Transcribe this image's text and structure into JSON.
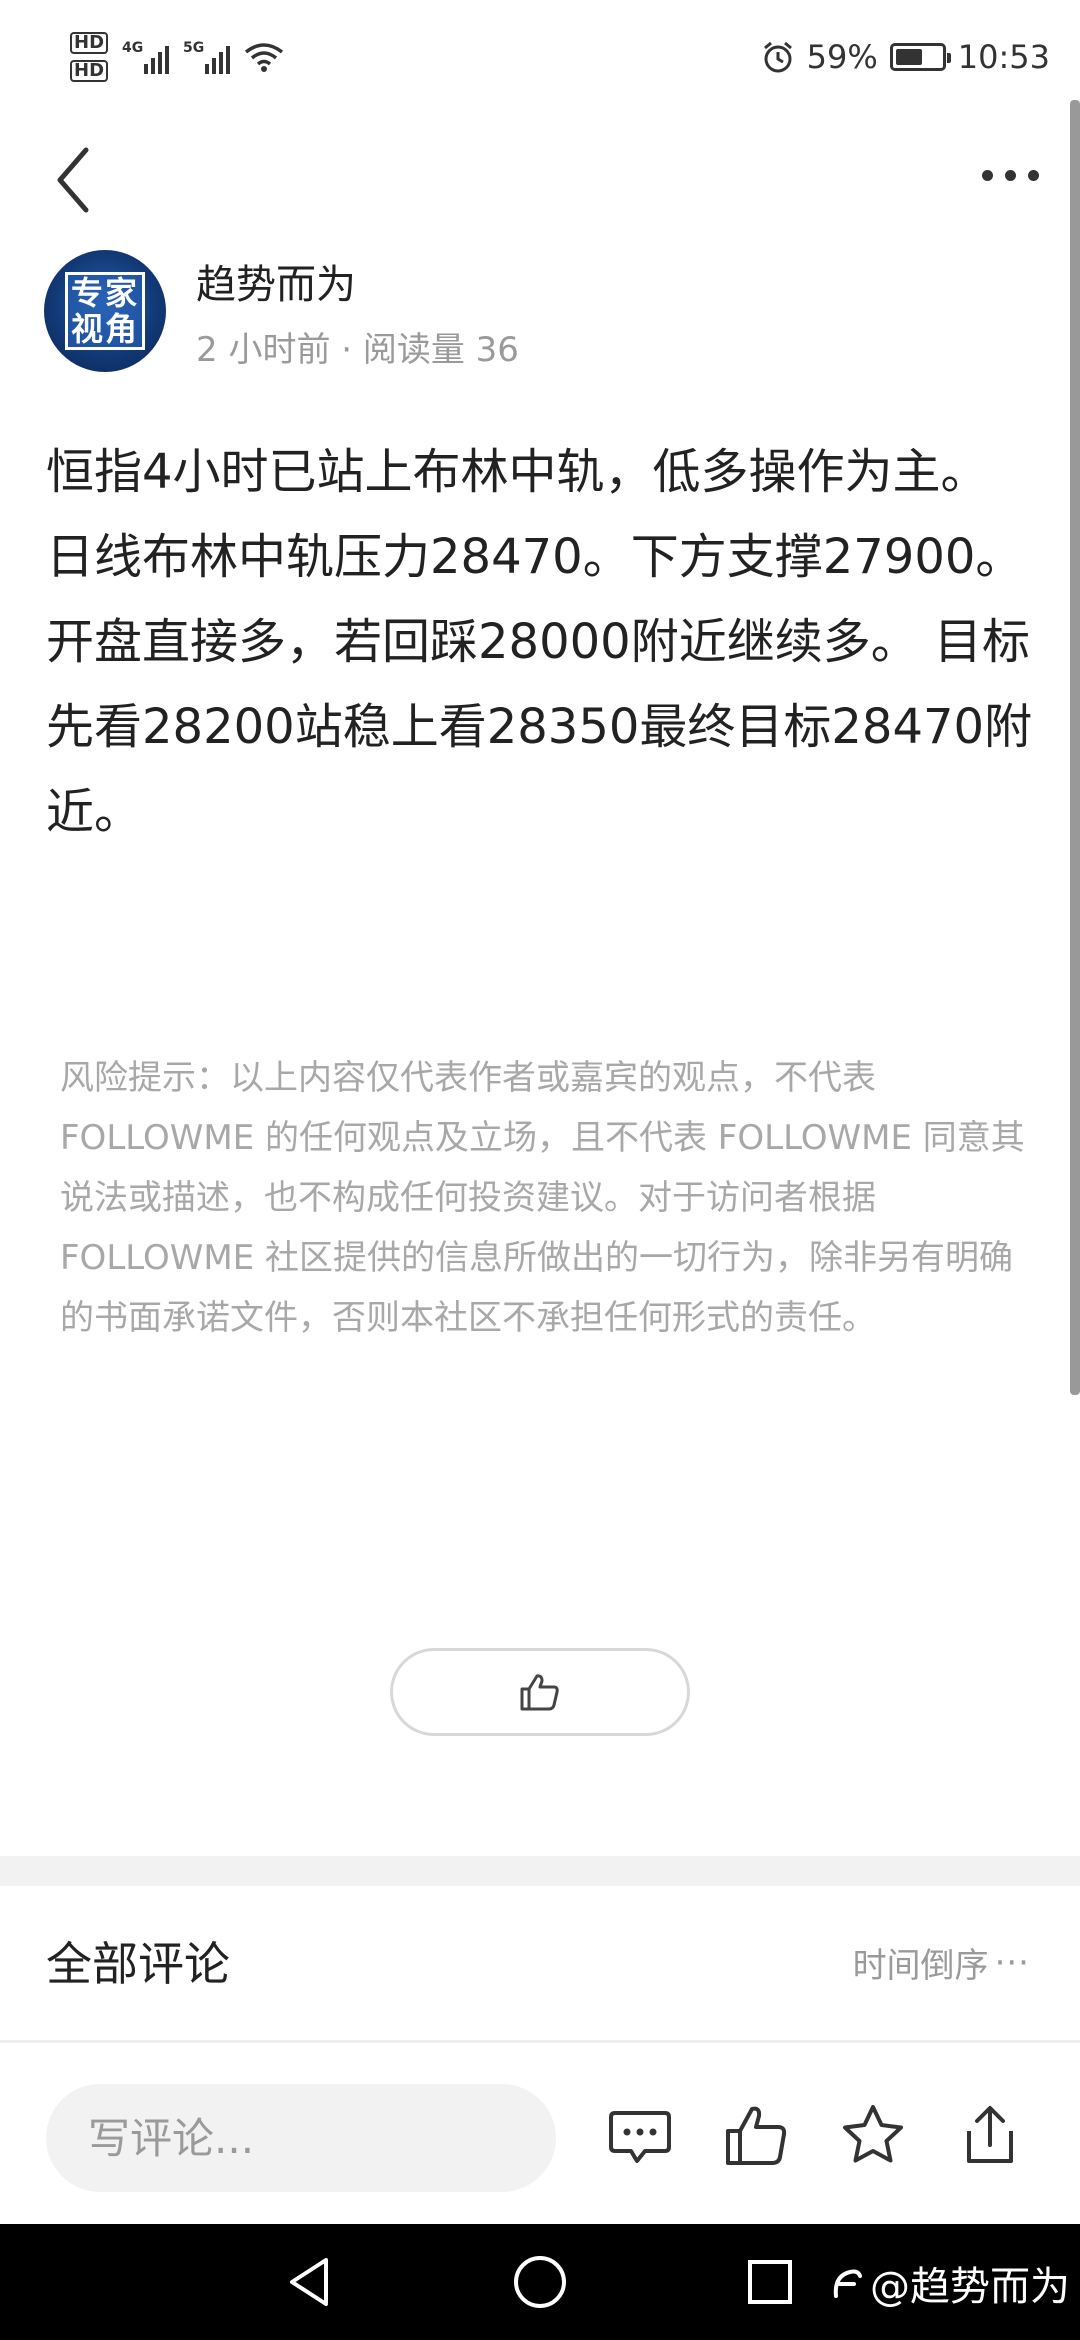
{
  "status_bar": {
    "hd1": "HD",
    "hd2": "HD",
    "net1": "4G",
    "net2": "5G",
    "battery": "59%",
    "battery_level": 0.59,
    "time": "10:53"
  },
  "author": {
    "avatar_text_line1": "专家",
    "avatar_text_line2": "视角",
    "name": "趋势而为",
    "meta": "2 小时前 · 阅读量 36"
  },
  "article": {
    "body": "恒指4小时已站上布林中轨，低多操作为主。 日线布林中轨压力28470。下方支撑27900。 开盘直接多，若回踩28000附近继续多。 目标先看28200站稳上看28350最终目标28470附近。"
  },
  "risk_notice": "风险提示：以上内容仅代表作者或嘉宾的观点，不代表 FOLLOWME 的任何观点及立场，且不代表 FOLLOWME 同意其说法或描述，也不构成任何投资建议。对于访问者根据 FOLLOWME 社区提供的信息所做出的一切行为，除非另有明确的书面承诺文件，否则本社区不承担任何形式的责任。",
  "comments": {
    "title": "全部评论",
    "sort_label": "时间倒序",
    "sort_more": "···"
  },
  "action_bar": {
    "input_placeholder": "写评论..."
  },
  "nav": {
    "watermark": "@趋势而为"
  },
  "icons": {
    "back": "chevron-left-icon",
    "more": "more-horizontal-icon",
    "like": "thumbs-up-icon",
    "comment": "comment-bubble-icon",
    "star": "star-icon",
    "share": "share-icon"
  },
  "colors": {
    "text": "#222222",
    "muted": "#9a9a9a",
    "risk": "#a8a8a8",
    "band": "#f2f2f2",
    "nav_bg": "#000000"
  }
}
